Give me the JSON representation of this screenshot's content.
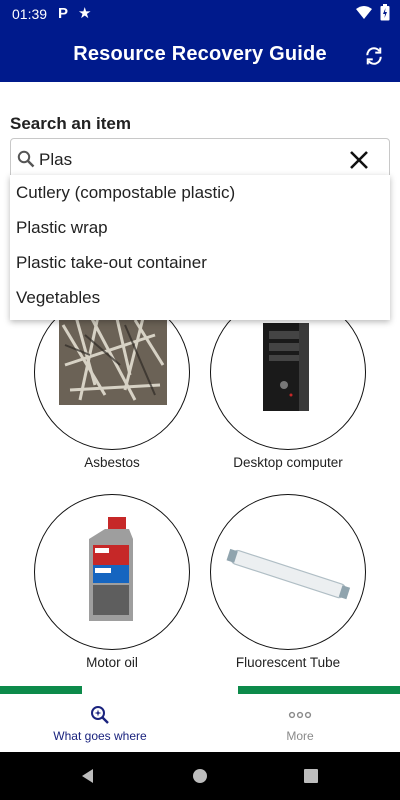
{
  "status_bar": {
    "time": "01:39",
    "notification_icons": [
      "parking-p-icon",
      "star-icon"
    ],
    "system_icons": [
      "wifi-icon",
      "battery-icon"
    ]
  },
  "app_bar": {
    "title": "Resource Recovery Guide",
    "action_icon": "refresh-icon",
    "color": "#001a8c"
  },
  "search": {
    "label": "Search an item",
    "value": "Plas",
    "icon": "search-icon",
    "clear_icon": "close-icon"
  },
  "suggestions": [
    "Cutlery (compostable plastic)",
    "Plastic wrap",
    "Plastic take-out container",
    "Vegetables"
  ],
  "items": [
    {
      "label": "Asbestos",
      "image": "asbestos-image"
    },
    {
      "label": "Desktop computer",
      "image": "desktop-computer-image"
    },
    {
      "label": "Motor oil",
      "image": "motor-oil-image"
    },
    {
      "label": "Fluorescent Tube",
      "image": "fluorescent-tube-image"
    }
  ],
  "bottom_nav": {
    "items": [
      {
        "label": "What goes where",
        "icon": "search-sparkle-icon",
        "active": true
      },
      {
        "label": "More",
        "icon": "more-dots-icon",
        "active": false
      }
    ],
    "active_color": "#1a237e",
    "inactive_color": "#8a8a8a",
    "accent_green": "#0d8a4a"
  },
  "system_nav": [
    "back-icon",
    "home-icon",
    "recents-icon"
  ]
}
